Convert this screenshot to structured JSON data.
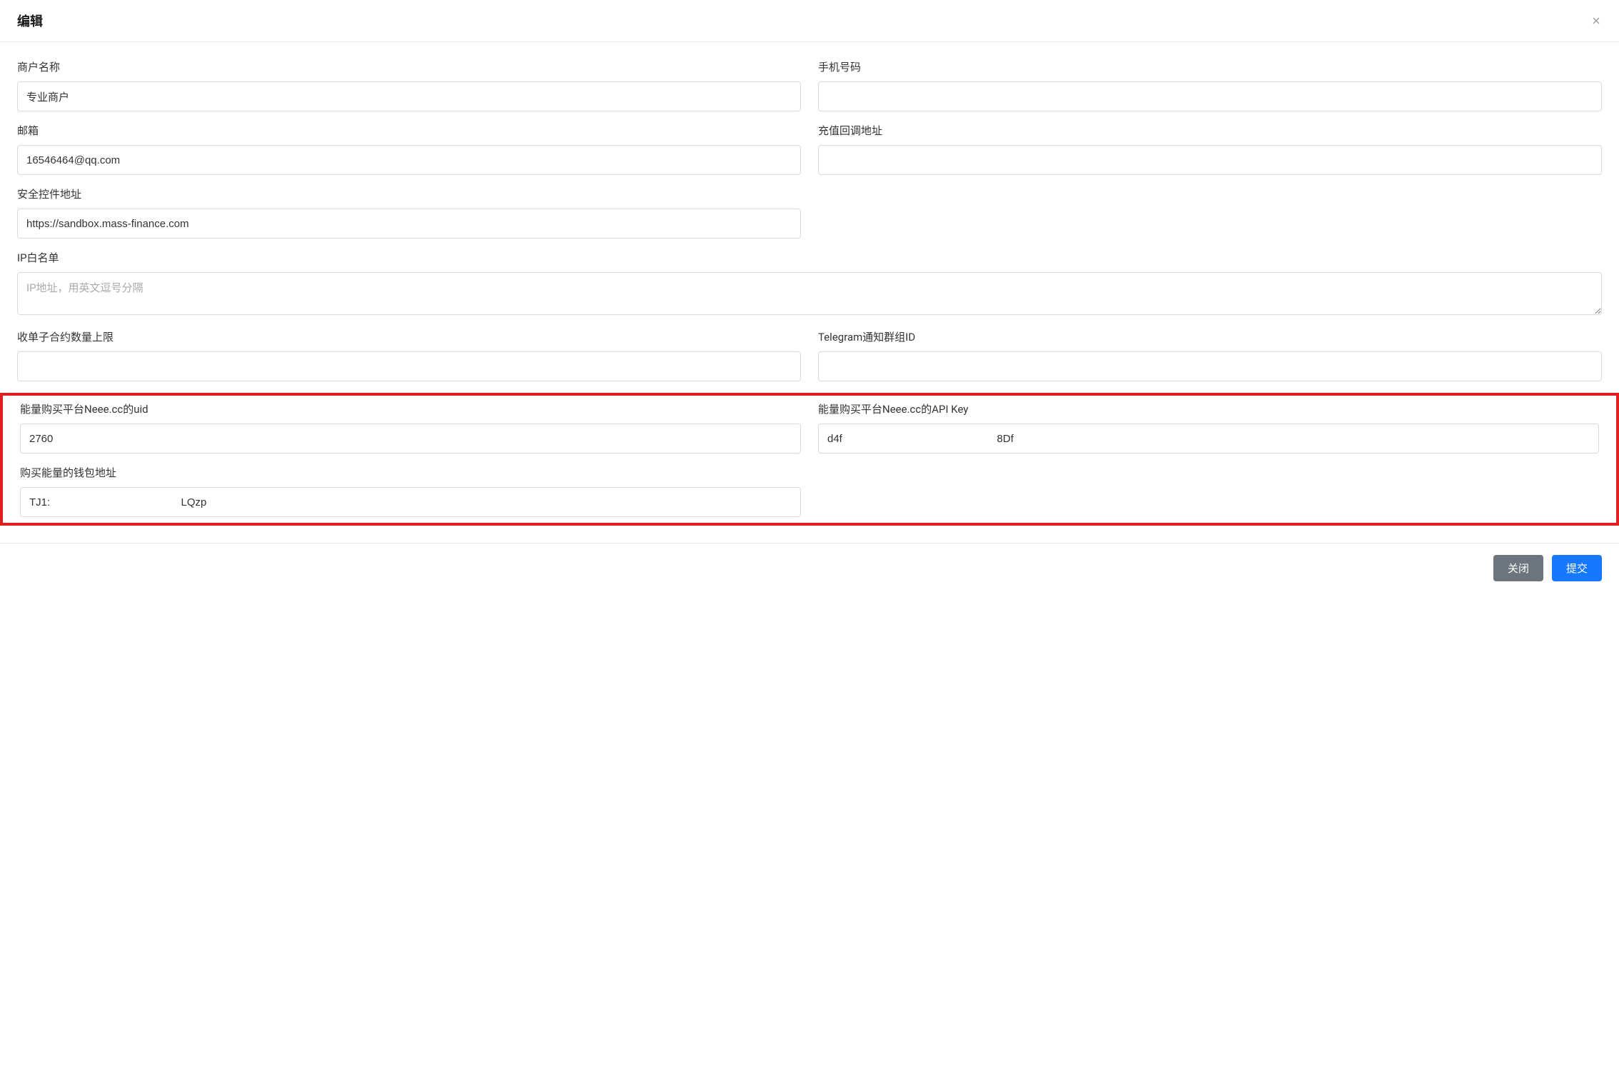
{
  "modal": {
    "title": "编辑",
    "close_button": "关闭",
    "submit_button": "提交"
  },
  "form": {
    "merchant_name": {
      "label": "商户名称",
      "value": "专业商户"
    },
    "phone": {
      "label": "手机号码",
      "value": ""
    },
    "email": {
      "label": "邮箱",
      "value": "16546464@qq.com"
    },
    "recharge_callback": {
      "label": "充值回调地址",
      "value": ""
    },
    "security_control_url": {
      "label": "安全控件地址",
      "value": "https://sandbox.mass-finance.com"
    },
    "ip_whitelist": {
      "label": "IP白名单",
      "placeholder": "IP地址，用英文逗号分隔",
      "value": ""
    },
    "subcontract_limit": {
      "label": "收单子合约数量上限",
      "value": ""
    },
    "telegram_group": {
      "label": "Telegram通知群组ID",
      "value": ""
    },
    "neee_uid": {
      "label": "能量购买平台Neee.cc的uid",
      "value": "2760"
    },
    "neee_api_key": {
      "label": "能量购买平台Neee.cc的API Key",
      "value": "d4f                                                    8Df"
    },
    "energy_wallet": {
      "label": "购买能量的钱包地址",
      "value": "TJ1:                                            LQzp"
    }
  }
}
